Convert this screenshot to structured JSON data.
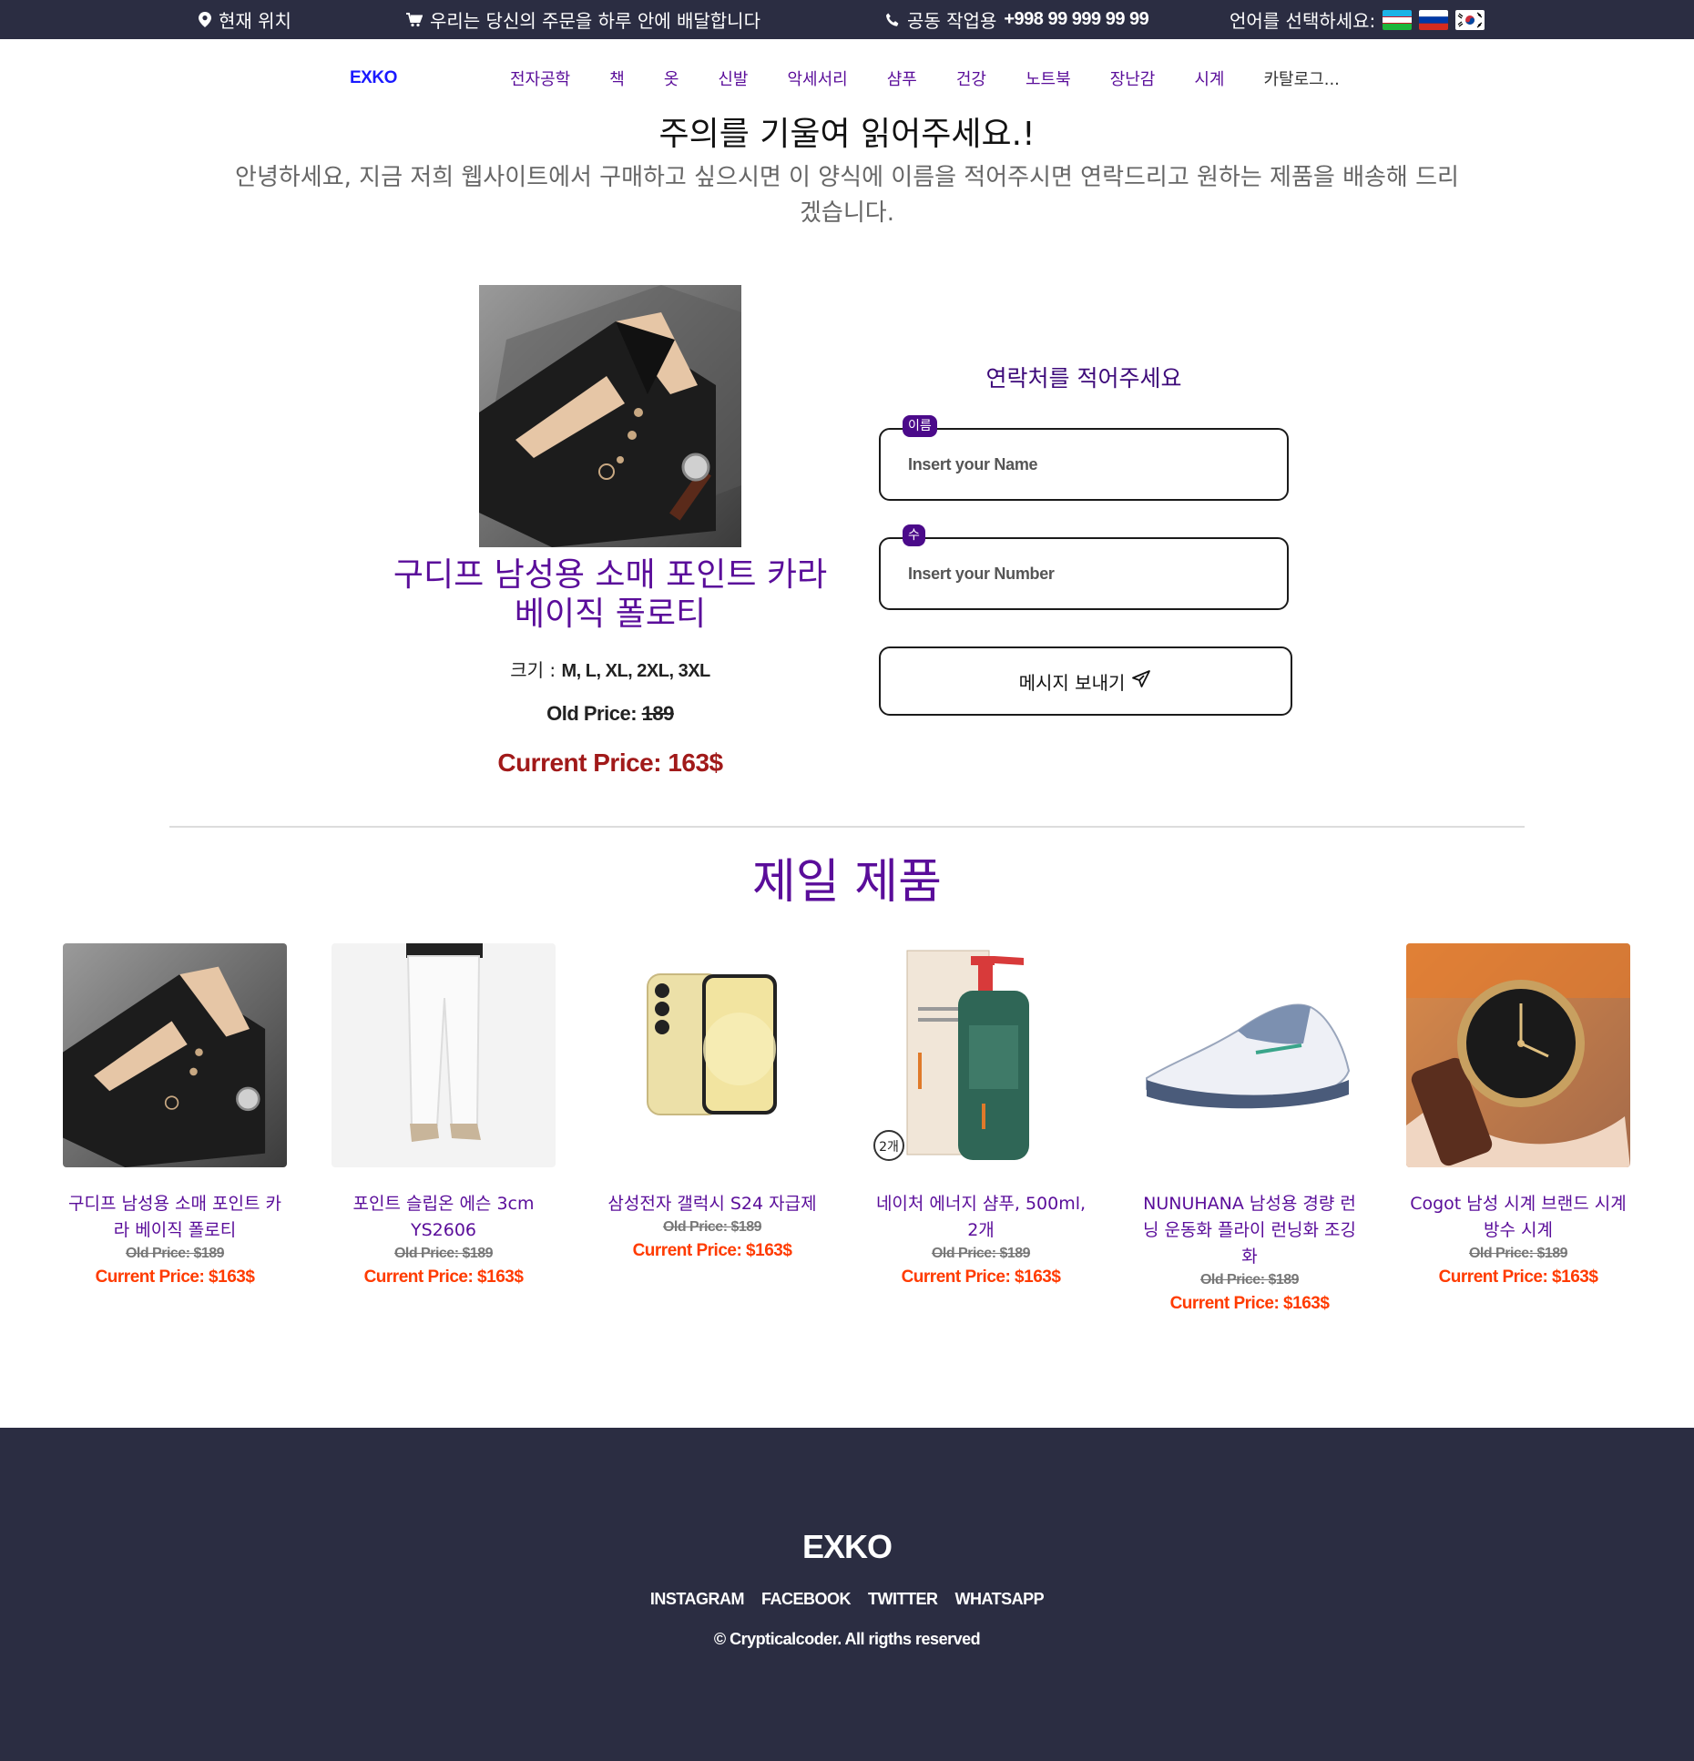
{
  "topbar": {
    "location": "현재 위치",
    "delivery": "우리는 당신의 주문을 하루 안에 배달합니다",
    "phone_label": "공동 작업용",
    "phone_number": "+998 99 999 99 99",
    "language_label": "언어를 선택하세요:",
    "languages": [
      "uz",
      "ru",
      "ko"
    ],
    "icons": [
      "location-pin-icon",
      "cart-icon",
      "phone-icon"
    ]
  },
  "nav": {
    "logo": "EXKO",
    "links": [
      "전자공학",
      "책",
      "옷",
      "신발",
      "악세서리",
      "샴푸",
      "건강",
      "노트북",
      "장난감",
      "시계",
      "카탈로그..."
    ]
  },
  "intro": {
    "title": "주의를 기울여 읽어주세요.!",
    "text": "안녕하세요, 지금 저희 웹사이트에서 구매하고 싶으시면 이 양식에 이름을 적어주시면 연락드리고 원하는 제품을 배송해 드리겠습니다."
  },
  "product": {
    "title": "구디프 남성용 소매 포인트 카라 베이직 폴로티",
    "size_label": "크기 :",
    "sizes": "M, L, XL, 2XL, 3XL",
    "old_price_label": "Old Price:",
    "old_price": "189",
    "current_price": "Current Price: 163$"
  },
  "form": {
    "title": "연락처를 적어주세요",
    "name_tag": "이름",
    "name_placeholder": "Insert your Name",
    "number_tag": "수",
    "number_placeholder": "Insert your Number",
    "send_label": "메시지 보내기"
  },
  "best": {
    "title": "제일 제품",
    "products": [
      {
        "title": "구디프 남성용 소매 포인트 카라 베이직 폴로티",
        "old_price": "Old Price: $189",
        "current_price": "Current Price: $163$"
      },
      {
        "title": "포인트 슬립온 에슨 3cm YS2606",
        "old_price": "Old Price: $189",
        "current_price": "Current Price: $163$"
      },
      {
        "title": "삼성전자 갤럭시 S24 자급제",
        "old_price": "Old Price: $189",
        "current_price": "Current Price: $163$"
      },
      {
        "title": "네이처 에너지 샴푸, 500ml, 2개",
        "old_price": "Old Price: $189",
        "current_price": "Current Price: $163$"
      },
      {
        "title": "NUNUHANA 남성용 경량 런닝 운동화 플라이 런닝화 조깅화",
        "old_price": "Old Price: $189",
        "current_price": "Current Price: $163$"
      },
      {
        "title": "Cogot 남성 시계 브랜드 시계 방수 시계",
        "old_price": "Old Price: $189",
        "current_price": "Current Price: $163$"
      }
    ]
  },
  "shampoo_badge": "2개",
  "footer": {
    "logo": "EXKO",
    "links": [
      "INSTAGRAM",
      "FACEBOOK",
      "TWITTER",
      "WHATSAPP"
    ],
    "copyright": "© Crypticalcoder. All rigths reserved"
  },
  "colors": {
    "dark_bar": "#2b2d42",
    "purple": "#5a0d9a",
    "price_red": "#a11a1a",
    "price_orange": "#ff3b00"
  }
}
